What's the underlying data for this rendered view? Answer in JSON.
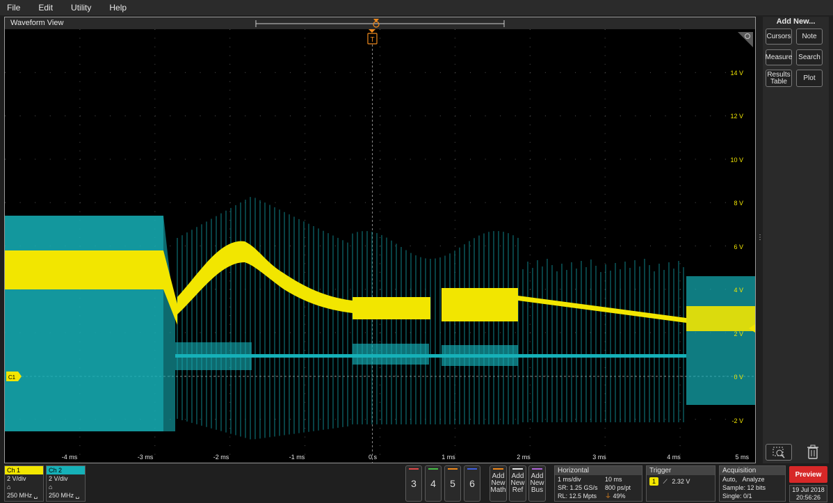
{
  "menu": [
    "File",
    "Edit",
    "Utility",
    "Help"
  ],
  "waveform": {
    "title": "Waveform View",
    "trigger_marker": "T",
    "channel_marker": "C1",
    "y_labels": [
      "14 V",
      "12 V",
      "10 V",
      "8 V",
      "6 V",
      "4 V",
      "2 V",
      "0 V",
      "-2 V"
    ],
    "x_labels": [
      "-4 ms",
      "-3 ms",
      "-2 ms",
      "-1 ms",
      "0 s",
      "1 ms",
      "2 ms",
      "3 ms",
      "4 ms",
      "5 ms"
    ],
    "colors": {
      "ch1": "#f2e600",
      "ch2": "#16b1b8",
      "trigger": "#f08a1c"
    }
  },
  "sidebar": {
    "title": "Add New...",
    "buttons": [
      "Cursors",
      "Note",
      "Measure",
      "Search",
      "Results Table",
      "Plot"
    ]
  },
  "channels": [
    {
      "name": "Ch 1",
      "scale": "2 V/div",
      "bandwidth": "250 MHz"
    },
    {
      "name": "Ch 2",
      "scale": "2 V/div",
      "bandwidth": "250 MHz"
    }
  ],
  "channel_buttons": [
    "3",
    "4",
    "5",
    "6"
  ],
  "add_buttons": [
    {
      "line1": "Add",
      "line2": "New",
      "line3": "Math"
    },
    {
      "line1": "Add",
      "line2": "New",
      "line3": "Ref"
    },
    {
      "line1": "Add",
      "line2": "New",
      "line3": "Bus"
    }
  ],
  "horizontal": {
    "title": "Horizontal",
    "scale": "1 ms/div",
    "record_time": "10 ms",
    "sample_rate": "SR: 1.25 GS/s",
    "resolution": "800 ps/pt",
    "record_length": "RL: 12.5 Mpts",
    "position": "49%"
  },
  "trigger": {
    "title": "Trigger",
    "source": "1",
    "level": "2.32 V"
  },
  "acquisition": {
    "title": "Acquisition",
    "mode": "Auto,",
    "analyze": "Analyze",
    "sample": "Sample: 12 bits",
    "single": "Single: 0/1"
  },
  "preview": "Preview",
  "date": "19 Jul 2018",
  "time": "20:56:26"
}
